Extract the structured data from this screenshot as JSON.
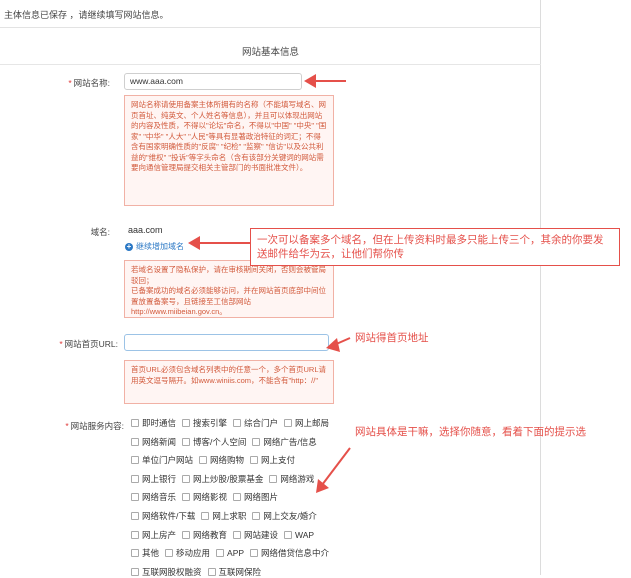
{
  "status_message": "主体信息已保存 ，请继续填写网站信息。",
  "section_title": "网站基本信息",
  "fields": {
    "site_name": {
      "label": "网站名称:",
      "required": "*",
      "value": "www.aaa.com",
      "note": "网站名称请使用备案主体所拥有的名称（不能填写域名、网页首址、纯英文、个人姓名等信息），并且可以体现出网站的内容及性质，不得以\"论坛\"命名，不得以\"中国\" \"中央\" \"国家\" \"中华\" \"人大\" \"人民\"等具有显著政治特征的词汇；不得含有国家明确性质的\"反腐\" \"纪检\" \"监察\" \"信访\"以及公共利益的\"维权\" \"投诉\"等字头命名（含有该部分关键词的网站需要向通信管理局提交相关主管部门的书面批准文件）。"
    },
    "domain": {
      "label": "域名:",
      "value": "aaa.com",
      "add_link": "继续增加域名",
      "note": "若域名设置了隐私保护，请在审核期间关闭，否则会被管局驳回；\n已备案成功的域名必须能够访问，并在网站首页底部中间位置放置备案号，且链接至工信部网站http://www.miibeian.gov.cn。"
    },
    "homepage_url": {
      "label": "网站首页URL:",
      "required": "*",
      "value": "",
      "note": "首页URL必须包含域名列表中的任意一个，多个首页URL请用英文逗号隔开。如www.winiis.com，不能含有\"http：//\""
    },
    "service_content": {
      "label": "网站服务内容:",
      "required": "*",
      "rows": [
        [
          "即时通信",
          "搜索引擎",
          "综合门户",
          "网上邮局"
        ],
        [
          "网络新闻",
          "博客/个人空间",
          "网络广告/信息"
        ],
        [
          "单位门户网站",
          "网络购物",
          "网上支付"
        ],
        [
          "网上银行",
          "网上炒股/股票基金",
          "网络游戏"
        ],
        [
          "网络音乐",
          "网络影视",
          "网络图片"
        ],
        [
          "网络软件/下载",
          "网上求职",
          "网上交友/婚介"
        ],
        [
          "网上房产",
          "网络教育",
          "网站建设",
          "WAP"
        ],
        [
          "其他",
          "移动应用",
          "APP",
          "网络借贷信息中介"
        ],
        [
          "互联网股权融资",
          "互联网保险"
        ]
      ]
    }
  },
  "annotations": {
    "domain_tip": "一次可以备案多个域名，但在上传资料时最多只能上传三个，其余的你要发送邮件给华为云，让他们帮你传",
    "homepage_tip": "网站得首页地址",
    "service_tip": "网站具体是干嘛，选择你随意，看着下面的提示选"
  },
  "colors": {
    "annotation_red": "#e5504a",
    "note_text": "#d25a3c",
    "link_blue": "#2b78c5"
  }
}
